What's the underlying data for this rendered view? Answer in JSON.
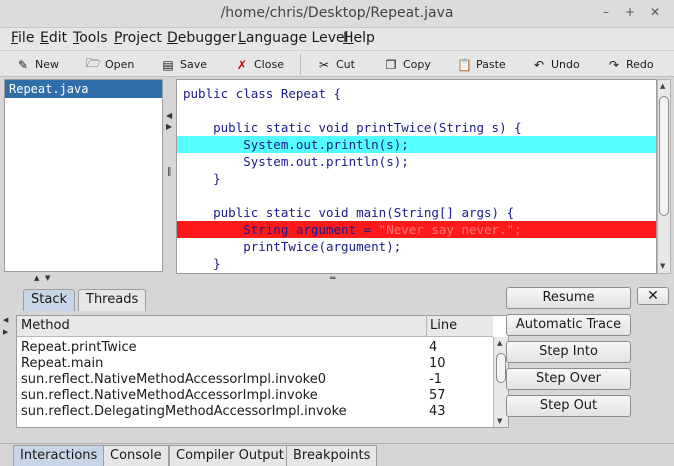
{
  "window": {
    "title": "/home/chris/Desktop/Repeat.java",
    "controls": [
      "minimize-icon",
      "maximize-icon",
      "close-icon"
    ]
  },
  "menu": {
    "file": "File",
    "edit": "Edit",
    "tools": "Tools",
    "project": "Project",
    "debugger": "Debugger",
    "language_level": "Language Level",
    "help": "Help"
  },
  "toolbar": {
    "new": "New",
    "open": "Open",
    "save": "Save",
    "close": "Close",
    "cut": "Cut",
    "copy": "Copy",
    "paste": "Paste",
    "undo": "Undo",
    "redo": "Redo"
  },
  "files": {
    "items": [
      "Repeat.java"
    ],
    "selected": "Repeat.java"
  },
  "editor": {
    "lines": [
      "public class Repeat {",
      "",
      "    public static void printTwice(String s) {",
      "        System.out.println(s);",
      "        System.out.println(s);",
      "    }",
      "",
      "    public static void main(String[] args) {",
      "        String argument = ",
      "\"Never say never.\";",
      "        printTwice(argument);",
      "    }"
    ],
    "highlight_cyan_color": "#55ffff",
    "highlight_red_color": "#ff1a1a"
  },
  "debug": {
    "tabs": {
      "stack": "Stack",
      "threads": "Threads"
    },
    "columns": {
      "method": "Method",
      "line": "Line"
    },
    "rows": [
      {
        "method": "Repeat.printTwice",
        "line": "4"
      },
      {
        "method": "Repeat.main",
        "line": "10"
      },
      {
        "method": "sun.reflect.NativeMethodAccessorImpl.invoke0",
        "line": "-1"
      },
      {
        "method": "sun.reflect.NativeMethodAccessorImpl.invoke",
        "line": "57"
      },
      {
        "method": "sun.reflect.DelegatingMethodAccessorImpl.invoke",
        "line": "43"
      }
    ],
    "buttons": {
      "resume": "Resume",
      "automatic_trace": "Automatic Trace",
      "step_into": "Step Into",
      "step_over": "Step Over",
      "step_out": "Step Out",
      "close": "✕"
    }
  },
  "bottom_tabs": {
    "interactions": "Interactions",
    "console": "Console",
    "compiler_output": "Compiler Output",
    "breakpoints": "Breakpoints",
    "active": "Interactions"
  }
}
